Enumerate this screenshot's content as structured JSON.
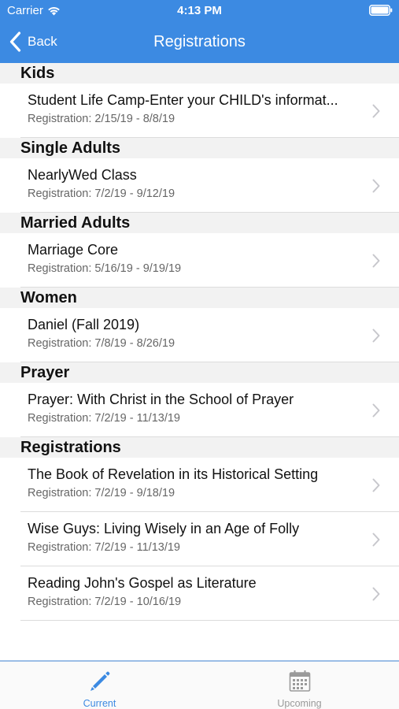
{
  "status": {
    "carrier": "Carrier",
    "time": "4:13 PM"
  },
  "nav": {
    "back_label": "Back",
    "title": "Registrations"
  },
  "sections": [
    {
      "header": "Kids",
      "items": [
        {
          "title": "Student Life Camp-Enter your CHILD's informat...",
          "subtitle": "Registration: 2/15/19 - 8/8/19"
        }
      ]
    },
    {
      "header": "Single Adults",
      "items": [
        {
          "title": "NearlyWed Class",
          "subtitle": "Registration: 7/2/19 - 9/12/19"
        }
      ]
    },
    {
      "header": "Married Adults",
      "items": [
        {
          "title": "Marriage Core",
          "subtitle": "Registration: 5/16/19 - 9/19/19"
        }
      ]
    },
    {
      "header": "Women",
      "items": [
        {
          "title": "Daniel (Fall 2019)",
          "subtitle": "Registration: 7/8/19 - 8/26/19"
        }
      ]
    },
    {
      "header": "Prayer",
      "items": [
        {
          "title": "Prayer: With Christ in the School of Prayer",
          "subtitle": "Registration: 7/2/19 - 11/13/19"
        }
      ]
    },
    {
      "header": "Registrations",
      "items": [
        {
          "title": "The Book of Revelation in its Historical Setting",
          "subtitle": "Registration: 7/2/19 - 9/18/19"
        },
        {
          "title": "Wise Guys: Living Wisely in an Age of Folly",
          "subtitle": "Registration: 7/2/19 - 11/13/19"
        },
        {
          "title": "Reading John's Gospel as Literature",
          "subtitle": "Registration: 7/2/19 - 10/16/19"
        }
      ]
    }
  ],
  "tabbar": {
    "tabs": [
      {
        "label": "Current",
        "icon": "pencil-icon",
        "active": true
      },
      {
        "label": "Upcoming",
        "icon": "calendar-icon",
        "active": false
      }
    ]
  },
  "colors": {
    "accent": "#3c8ae2",
    "tab_inactive": "#9a9a9a",
    "section_bg": "#f2f2f2",
    "subtitle": "#666666"
  }
}
